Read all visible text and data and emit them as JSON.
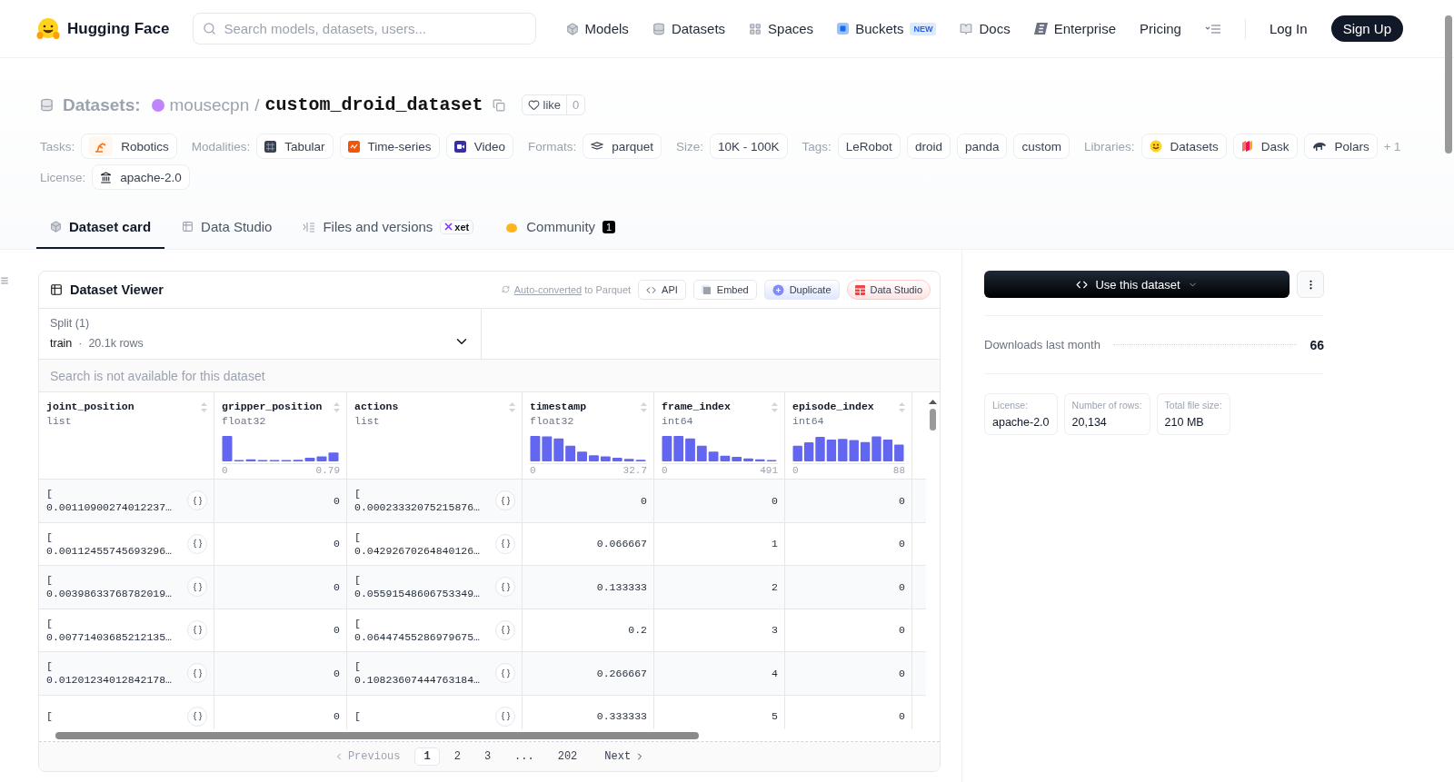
{
  "nav": {
    "brand": "Hugging Face",
    "search_placeholder": "Search models, datasets, users...",
    "links": [
      {
        "label": "Models"
      },
      {
        "label": "Datasets"
      },
      {
        "label": "Spaces"
      },
      {
        "label": "Buckets",
        "badge": "NEW"
      },
      {
        "label": "Docs"
      },
      {
        "label": "Enterprise"
      },
      {
        "label": "Pricing"
      }
    ],
    "login": "Log In",
    "signup": "Sign Up"
  },
  "header": {
    "category": "Datasets:",
    "owner": "mousecpn",
    "separator": "/",
    "name": "custom_droid_dataset",
    "like_label": "like",
    "like_count": "0"
  },
  "meta_rows": [
    [
      {
        "label": "Tasks:",
        "tags": [
          "Robotics"
        ]
      },
      {
        "label": "Modalities:",
        "tags": [
          "Tabular",
          "Time-series",
          "Video"
        ]
      },
      {
        "label": "Formats:",
        "tags": [
          "parquet"
        ]
      },
      {
        "label": "Size:",
        "tags": [
          "10K - 100K"
        ]
      },
      {
        "label": "Tags:",
        "tags": [
          "LeRobot",
          "droid",
          "panda",
          "custom"
        ]
      },
      {
        "label": "Libraries:",
        "tags": [
          "Datasets",
          "Dask",
          "Polars"
        ],
        "more": "+ 1"
      }
    ],
    [
      {
        "label": "License:",
        "tags": [
          "apache-2.0"
        ]
      }
    ]
  ],
  "tabs": [
    {
      "label": "Dataset card",
      "selected": true
    },
    {
      "label": "Data Studio",
      "selected": false
    },
    {
      "label": "Files and versions",
      "badge": "xet",
      "selected": false
    },
    {
      "label": "Community",
      "count": "1",
      "selected": false
    }
  ],
  "viewer": {
    "title": "Dataset Viewer",
    "auto_link": "Auto-converted",
    "auto_rest": "to Parquet",
    "buttons": [
      "API",
      "Embed",
      "Duplicate",
      "Data Studio"
    ],
    "split": {
      "label": "Split (1)",
      "value": "train",
      "separator": "·",
      "rows": "20.1k rows"
    },
    "search_placeholder": "Search is not available for this dataset",
    "columns": [
      {
        "name": "joint_position",
        "type": "list"
      },
      {
        "name": "gripper_position",
        "type": "float32",
        "histogram": {
          "min": "0",
          "max": "0.79"
        }
      },
      {
        "name": "actions",
        "type": "list"
      },
      {
        "name": "timestamp",
        "type": "float32",
        "histogram": {
          "min": "0",
          "max": "32.7"
        }
      },
      {
        "name": "frame_index",
        "type": "int64",
        "histogram": {
          "min": "0",
          "max": "491"
        }
      },
      {
        "name": "episode_index",
        "type": "int64",
        "histogram": {
          "min": "0",
          "max": "88"
        }
      }
    ],
    "rows": [
      {
        "cells": [
          {
            "open": "[",
            "value": "0.00110900274012237…"
          },
          {
            "value": "0"
          },
          {
            "open": "[",
            "value": "0.00023332075215876…"
          },
          {
            "value": "0"
          },
          {
            "value": "0"
          },
          {
            "value": "0"
          }
        ]
      },
      {
        "cells": [
          {
            "open": "[",
            "value": "0.00112455745693296…"
          },
          {
            "value": "0"
          },
          {
            "open": "[",
            "value": "0.04292670264840126…"
          },
          {
            "value": "0.066667"
          },
          {
            "value": "1"
          },
          {
            "value": "0"
          }
        ]
      },
      {
        "cells": [
          {
            "open": "[",
            "value": "0.00398633768782019…"
          },
          {
            "value": "0"
          },
          {
            "open": "[",
            "value": "0.05591548606753349…"
          },
          {
            "value": "0.133333"
          },
          {
            "value": "2"
          },
          {
            "value": "0"
          }
        ]
      },
      {
        "cells": [
          {
            "open": "[",
            "value": "0.00771403685212135…"
          },
          {
            "value": "0"
          },
          {
            "open": "[",
            "value": "0.06447455286979675…"
          },
          {
            "value": "0.2"
          },
          {
            "value": "3"
          },
          {
            "value": "0"
          }
        ]
      },
      {
        "cells": [
          {
            "open": "[",
            "value": "0.01201234012842178…"
          },
          {
            "value": "0"
          },
          {
            "open": "[",
            "value": "0.10823607444763184…"
          },
          {
            "value": "0.266667"
          },
          {
            "value": "4"
          },
          {
            "value": "0"
          }
        ]
      },
      {
        "cells": [
          {
            "open": "["
          },
          {
            "value": "0"
          },
          {
            "open": "["
          },
          {
            "value": "0.333333"
          },
          {
            "value": "5"
          },
          {
            "value": "0"
          }
        ]
      }
    ],
    "pagination": {
      "previous": "Previous",
      "pages": [
        {
          "label": "1",
          "selected": true
        },
        {
          "label": "2",
          "selected": false
        },
        {
          "label": "3",
          "selected": false
        },
        {
          "label": "...",
          "selected": false
        },
        {
          "label": "202",
          "selected": false
        }
      ],
      "next": "Next"
    }
  },
  "sidebar": {
    "use_button": "Use this dataset",
    "downloads_label": "Downloads last month",
    "downloads_value": "66",
    "stats": [
      {
        "label": "License:",
        "value": "apache-2.0"
      },
      {
        "label": "Number of rows:",
        "value": "20,134"
      },
      {
        "label": "Total file size:",
        "value": "210 MB"
      }
    ]
  }
}
